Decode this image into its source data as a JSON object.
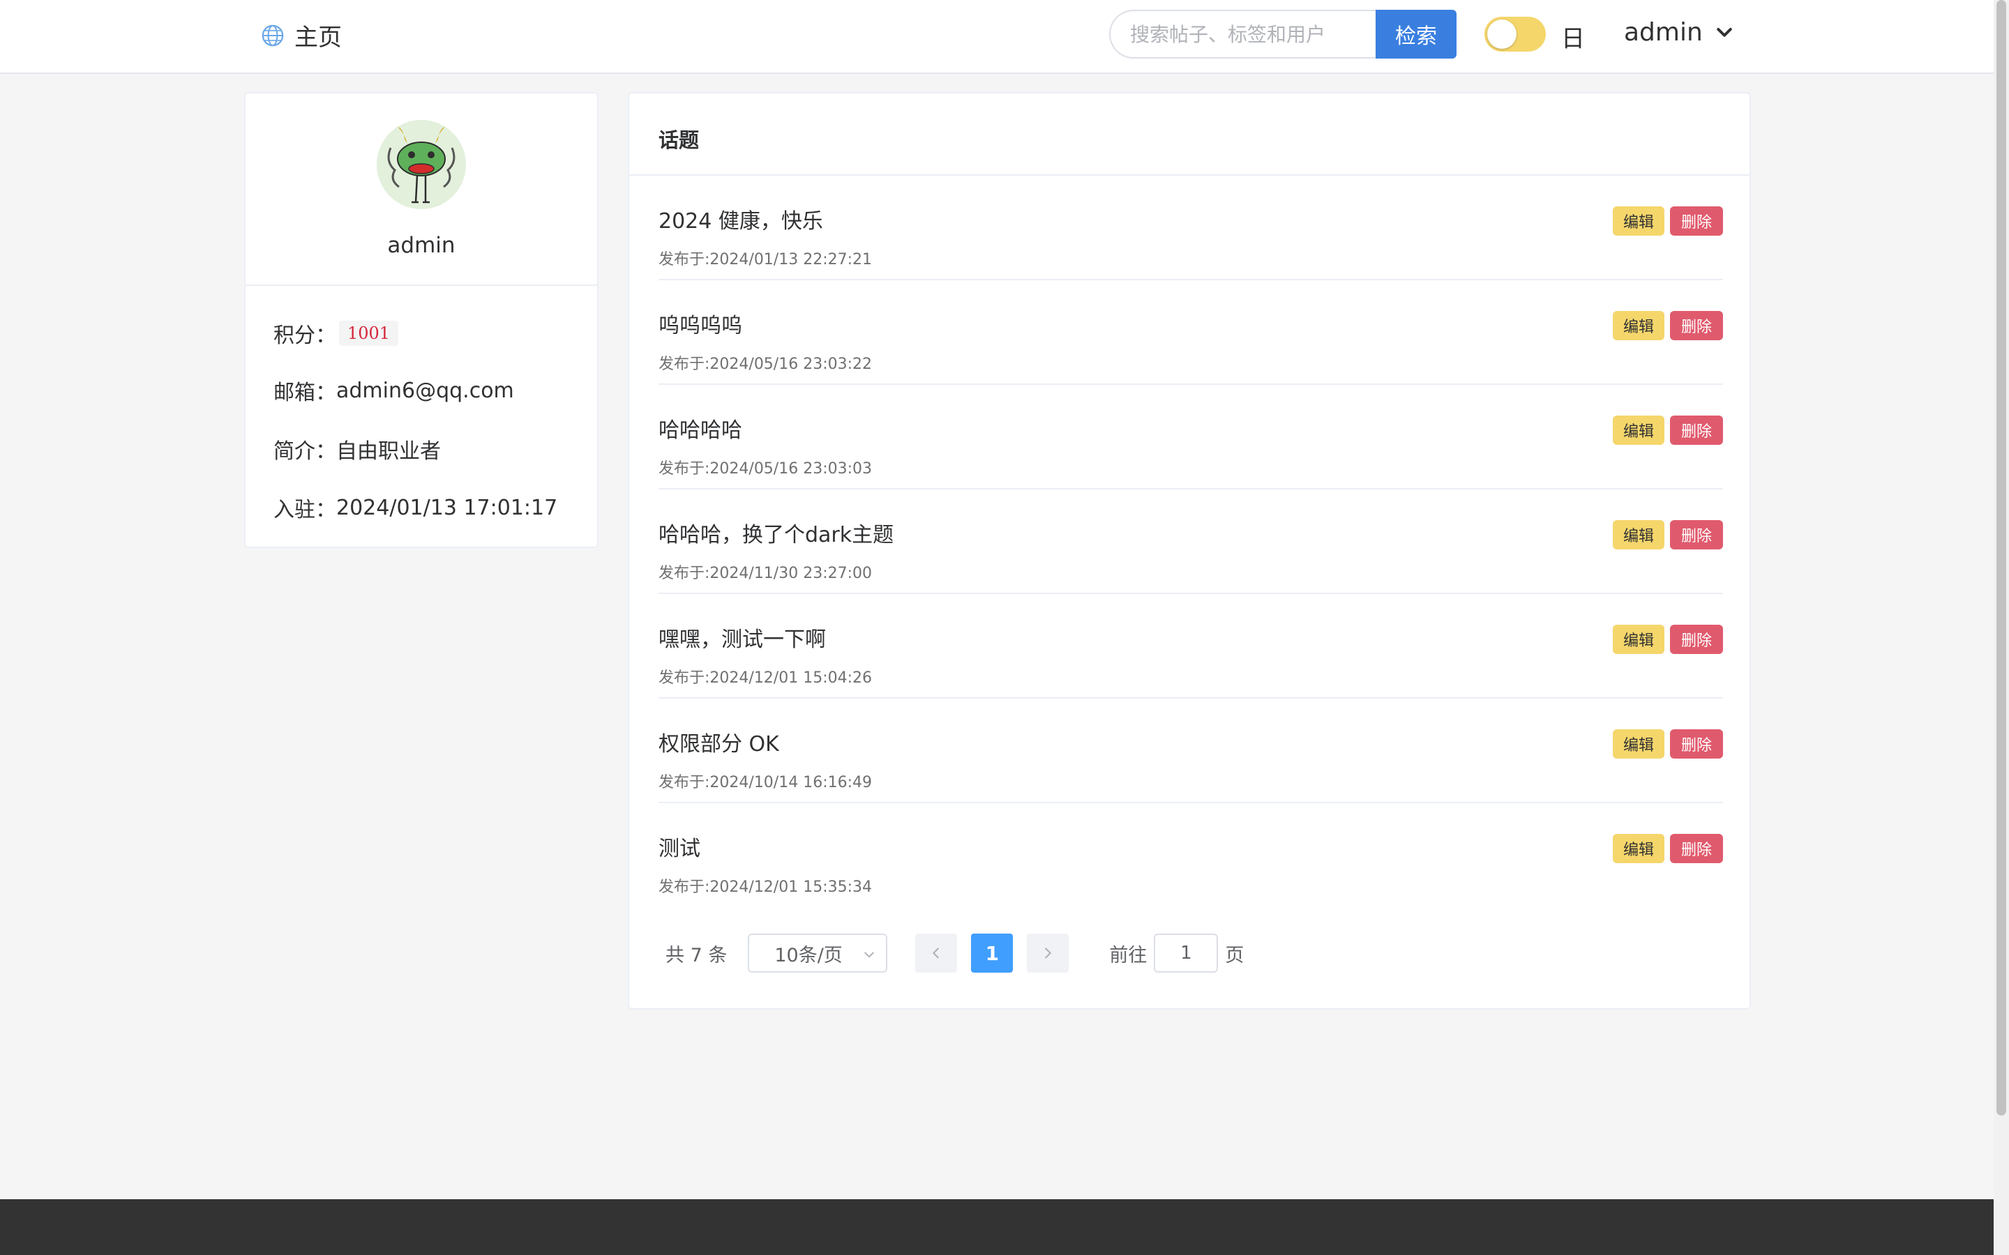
{
  "header": {
    "home_label": "主页",
    "search_placeholder": "搜索帖子、标签和用户",
    "search_button": "检索",
    "theme_label": "日",
    "user_name": "admin",
    "accent_color": "#3a7fe0"
  },
  "profile": {
    "name": "admin",
    "points_label": "积分：",
    "points_value": "1001",
    "email_label": "邮箱：",
    "email_value": "admin6@qq.com",
    "bio_label": "简介：",
    "bio_value": "自由职业者",
    "joined_label": "入驻：",
    "joined_value": "2024/01/13 17:01:17"
  },
  "topics": {
    "title": "话题",
    "edit_label": "编辑",
    "delete_label": "删除",
    "items": [
      {
        "title": "2024 健康，快乐",
        "time": "发布于:2024/01/13 22:27:21"
      },
      {
        "title": "呜呜呜呜",
        "time": "发布于:2024/05/16 23:03:22"
      },
      {
        "title": "哈哈哈哈",
        "time": "发布于:2024/05/16 23:03:03"
      },
      {
        "title": "哈哈哈，换了个dark主题",
        "time": "发布于:2024/11/30 23:27:00"
      },
      {
        "title": "嘿嘿，测试一下啊",
        "time": "发布于:2024/12/01 15:04:26"
      },
      {
        "title": "权限部分 OK",
        "time": "发布于:2024/10/14 16:16:49"
      },
      {
        "title": "测试",
        "time": "发布于:2024/12/01 15:35:34"
      }
    ]
  },
  "pagination": {
    "total": "共 7 条",
    "page_size": "10条/页",
    "current_page": "1",
    "goto_label": "前往",
    "goto_value": "1",
    "page_suffix": "页"
  }
}
